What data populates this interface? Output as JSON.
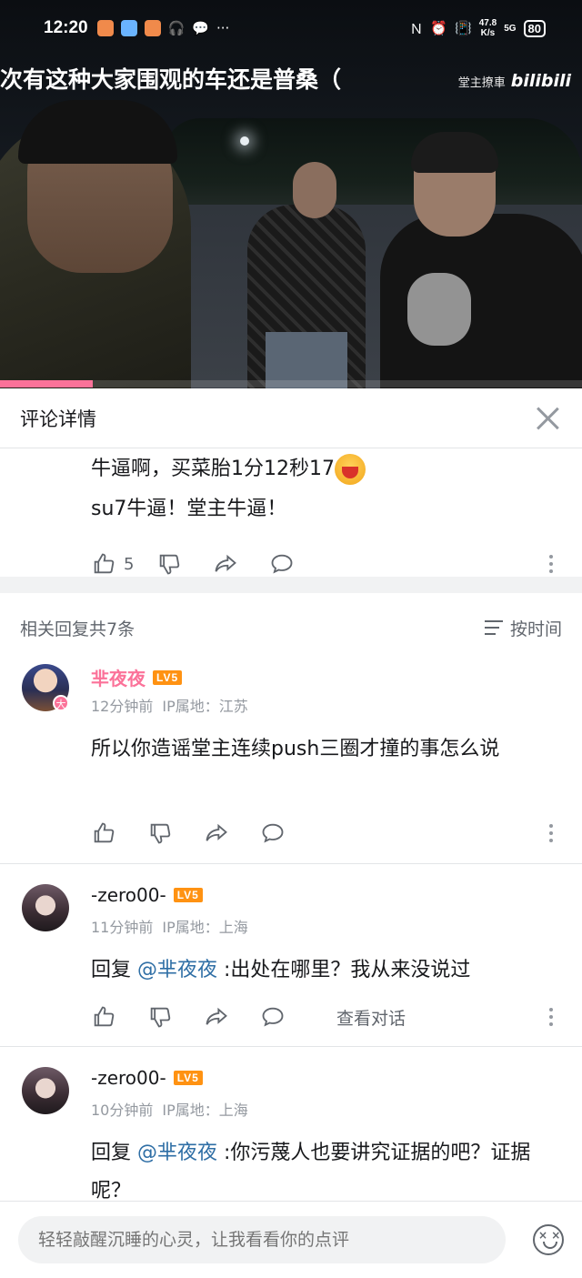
{
  "status_bar": {
    "time": "12:20",
    "net_speed_top": "47.8",
    "net_speed_bottom": "K/s",
    "signal": "5G",
    "battery": "80",
    "more_glyph": "···"
  },
  "video": {
    "title": "次有这种大家围观的车还是普桑（",
    "channel": "堂主撩車",
    "logo": "bilibili",
    "progress_percent": 16
  },
  "panel": {
    "title": "评论详情"
  },
  "main_comment": {
    "line1": "牛逼啊，买菜胎1分12秒17",
    "line2": "su7牛逼！堂主牛逼！",
    "like_count": "5"
  },
  "replies_header": {
    "count_label": "相关回复共7条",
    "sort_label": "按时间"
  },
  "replies": [
    {
      "username": "芈夜夜",
      "level": "LV5",
      "time": "12分钟前",
      "location": "IP属地：江苏",
      "text": "所以你造谣堂主连续push三圈才撞的事怎么说",
      "avatar_badge": "大"
    },
    {
      "username": "-zero00-",
      "level": "LV5",
      "time": "11分钟前",
      "location": "IP属地：上海",
      "reply_prefix": "回复 ",
      "mention": "@芈夜夜",
      "text": " :出处在哪里？我从来没说过",
      "view_dialog": "查看对话"
    },
    {
      "username": "-zero00-",
      "level": "LV5",
      "time": "10分钟前",
      "location": "IP属地：上海",
      "reply_prefix": "回复 ",
      "mention": "@芈夜夜",
      "text": " :你污蔑人也要讲究证据的吧？证据呢？"
    }
  ],
  "input": {
    "placeholder": "轻轻敲醒沉睡的心灵，让我看看你的点评"
  },
  "colors": {
    "accent_pink": "#fb7299",
    "mention_blue": "#2e6ea5",
    "level_orange": "#ff9212"
  }
}
